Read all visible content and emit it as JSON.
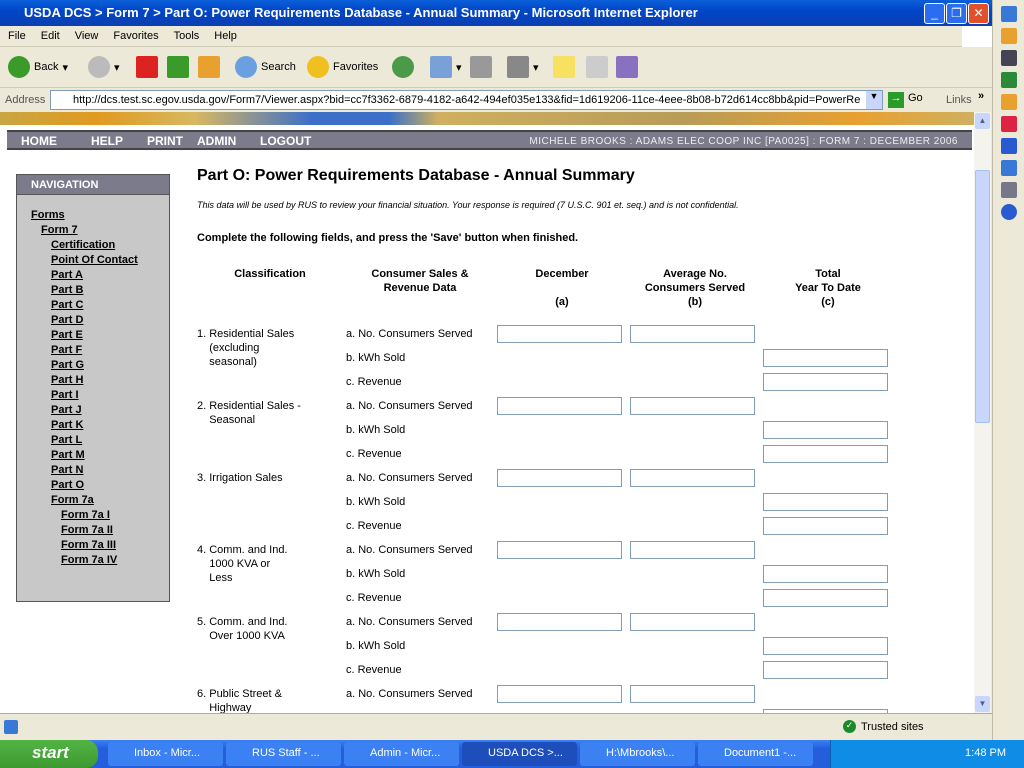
{
  "window": {
    "title": "USDA DCS > Form 7 > Part O: Power Requirements Database - Annual Summary - Microsoft Internet Explorer"
  },
  "menu": [
    "File",
    "Edit",
    "View",
    "Favorites",
    "Tools",
    "Help"
  ],
  "toolbar": {
    "back": "Back",
    "search": "Search",
    "favorites": "Favorites"
  },
  "address": {
    "label": "Address",
    "url": "http://dcs.test.sc.egov.usda.gov/Form7/Viewer.aspx?bid=cc7f3362-6879-4182-a642-494ef035e133&fid=1d619206-11ce-4eee-8b08-b72d614cc8bb&pid=PowerRe",
    "go": "Go",
    "links": "Links"
  },
  "topnav": {
    "items": [
      "HOME",
      "HELP",
      "PRINT",
      "ADMIN",
      "LOGOUT"
    ],
    "user": "MICHELE BROOKS : ADAMS ELEC COOP INC [PA0025] : FORM 7 : DECEMBER 2006"
  },
  "sidenav": {
    "title": "NAVIGATION",
    "links": [
      {
        "label": "Forms",
        "level": 0
      },
      {
        "label": "Form 7",
        "level": 1
      },
      {
        "label": "Certification",
        "level": 2
      },
      {
        "label": "Point Of Contact",
        "level": 2
      },
      {
        "label": "Part A",
        "level": 2
      },
      {
        "label": "Part B",
        "level": 2
      },
      {
        "label": "Part C",
        "level": 2
      },
      {
        "label": "Part D",
        "level": 2
      },
      {
        "label": "Part E",
        "level": 2
      },
      {
        "label": "Part F",
        "level": 2
      },
      {
        "label": "Part G",
        "level": 2
      },
      {
        "label": "Part H",
        "level": 2
      },
      {
        "label": "Part I",
        "level": 2
      },
      {
        "label": "Part J",
        "level": 2
      },
      {
        "label": "Part K",
        "level": 2
      },
      {
        "label": "Part L",
        "level": 2
      },
      {
        "label": "Part M",
        "level": 2
      },
      {
        "label": "Part N",
        "level": 2
      },
      {
        "label": "Part O",
        "level": 2
      },
      {
        "label": "Form 7a",
        "level": 2
      },
      {
        "label": "Form 7a I",
        "level": 3
      },
      {
        "label": "Form 7a II",
        "level": 3
      },
      {
        "label": "Form 7a III",
        "level": 3
      },
      {
        "label": "Form 7a IV",
        "level": 3
      }
    ]
  },
  "page": {
    "title": "Part O: Power Requirements Database - Annual Summary",
    "note": "This data will be used by RUS to review your financial situation. Your response is required (7 U.S.C. 901 et. seq.) and is not confidential.",
    "instructions": "Complete the following fields, and press the 'Save' button when finished.",
    "columns": {
      "classification": "Classification",
      "data": "Consumer Sales &\nRevenue Data",
      "a": "December\n\n(a)",
      "b": "Average No.\nConsumers Served\n(b)",
      "c": "Total\nYear To Date\n(c)"
    },
    "subrows": [
      "a. No. Consumers Served",
      "b. kWh Sold",
      "c. Revenue"
    ],
    "classes": [
      "1. Residential Sales\n    (excluding\n    seasonal)",
      "2. Residential Sales -\n    Seasonal",
      "3. Irrigation Sales",
      "4. Comm. and Ind.\n    1000 KVA or\n    Less",
      "5. Comm. and Ind.\n    Over 1000 KVA",
      "6. Public Street &\n    Highway"
    ]
  },
  "status": {
    "zone": "Trusted sites"
  },
  "taskbar": {
    "start": "start",
    "tasks": [
      "Inbox - Micr...",
      "RUS Staff - ...",
      "Admin - Micr...",
      "USDA DCS >...",
      "H:\\Mbrooks\\...",
      "Document1 -..."
    ],
    "active": 3,
    "clock": "1:48 PM"
  }
}
